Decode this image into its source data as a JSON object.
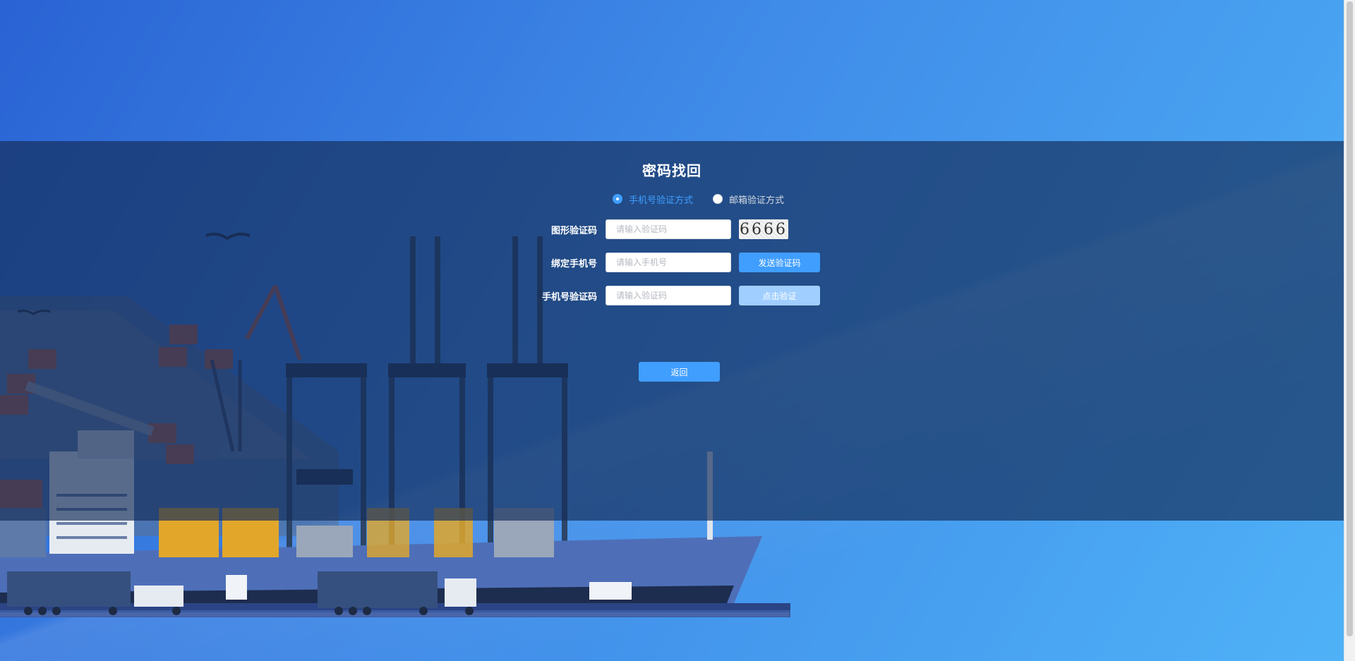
{
  "page": {
    "title": "密码找回"
  },
  "method_options": [
    {
      "label": "手机号验证方式",
      "checked": true
    },
    {
      "label": "邮箱验证方式",
      "checked": false
    }
  ],
  "form": {
    "captcha_label": "图形验证码",
    "captcha_placeholder": "请输入验证码",
    "captcha_image_text": "6666",
    "phone_label": "绑定手机号",
    "phone_placeholder": "请输入手机号",
    "send_code_label": "发送验证码",
    "sms_label": "手机号验证码",
    "sms_placeholder": "请输入验证码",
    "verify_label": "点击验证"
  },
  "back_label": "返回",
  "colors": {
    "accent": "#409eff",
    "accent_disabled": "#a0cfff",
    "overlay": "#1e3a66"
  }
}
